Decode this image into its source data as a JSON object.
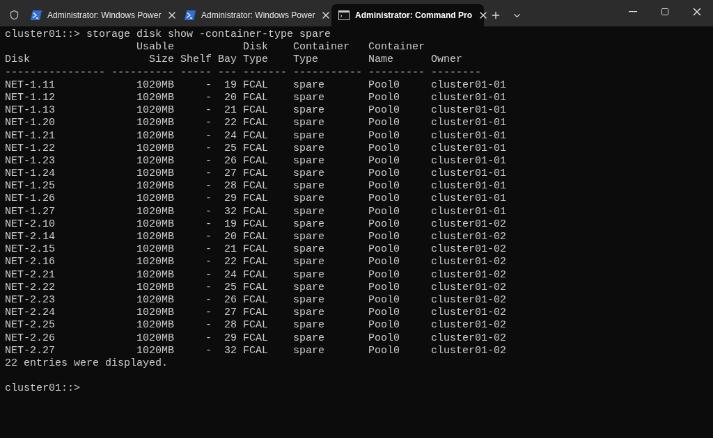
{
  "tabs": [
    {
      "kind": "powershell",
      "title": "Administrator: Windows Power",
      "selected": false
    },
    {
      "kind": "powershell",
      "title": "Administrator: Windows Power",
      "selected": false
    },
    {
      "kind": "cmd",
      "title": "Administrator: Command Pro",
      "selected": true
    }
  ],
  "terminal": {
    "prompt": "cluster01::>",
    "command": "storage disk show -container-type spare",
    "columns": [
      {
        "label": "Disk",
        "rule": "----------------",
        "kind": "text"
      },
      {
        "top": "Usable",
        "label": "Size",
        "rule": "----------",
        "kind": "number"
      },
      {
        "label": "Shelf",
        "rule": "-----",
        "kind": "number"
      },
      {
        "label": "Bay",
        "rule": "---",
        "kind": "number"
      },
      {
        "top": "Disk",
        "label": "Type",
        "rule": "-------",
        "kind": "text"
      },
      {
        "top": "Container",
        "label": "Type",
        "rule": "-----------",
        "kind": "text"
      },
      {
        "top": "Container",
        "label": "Name",
        "rule": "---------",
        "kind": "text"
      },
      {
        "label": "Owner",
        "rule": "--------",
        "kind": "text"
      }
    ],
    "rows": [
      [
        "NET-1.11",
        "1020MB",
        "-",
        "19",
        "FCAL",
        "spare",
        "Pool0",
        "cluster01-01"
      ],
      [
        "NET-1.12",
        "1020MB",
        "-",
        "20",
        "FCAL",
        "spare",
        "Pool0",
        "cluster01-01"
      ],
      [
        "NET-1.13",
        "1020MB",
        "-",
        "21",
        "FCAL",
        "spare",
        "Pool0",
        "cluster01-01"
      ],
      [
        "NET-1.20",
        "1020MB",
        "-",
        "22",
        "FCAL",
        "spare",
        "Pool0",
        "cluster01-01"
      ],
      [
        "NET-1.21",
        "1020MB",
        "-",
        "24",
        "FCAL",
        "spare",
        "Pool0",
        "cluster01-01"
      ],
      [
        "NET-1.22",
        "1020MB",
        "-",
        "25",
        "FCAL",
        "spare",
        "Pool0",
        "cluster01-01"
      ],
      [
        "NET-1.23",
        "1020MB",
        "-",
        "26",
        "FCAL",
        "spare",
        "Pool0",
        "cluster01-01"
      ],
      [
        "NET-1.24",
        "1020MB",
        "-",
        "27",
        "FCAL",
        "spare",
        "Pool0",
        "cluster01-01"
      ],
      [
        "NET-1.25",
        "1020MB",
        "-",
        "28",
        "FCAL",
        "spare",
        "Pool0",
        "cluster01-01"
      ],
      [
        "NET-1.26",
        "1020MB",
        "-",
        "29",
        "FCAL",
        "spare",
        "Pool0",
        "cluster01-01"
      ],
      [
        "NET-1.27",
        "1020MB",
        "-",
        "32",
        "FCAL",
        "spare",
        "Pool0",
        "cluster01-01"
      ],
      [
        "NET-2.10",
        "1020MB",
        "-",
        "19",
        "FCAL",
        "spare",
        "Pool0",
        "cluster01-02"
      ],
      [
        "NET-2.14",
        "1020MB",
        "-",
        "20",
        "FCAL",
        "spare",
        "Pool0",
        "cluster01-02"
      ],
      [
        "NET-2.15",
        "1020MB",
        "-",
        "21",
        "FCAL",
        "spare",
        "Pool0",
        "cluster01-02"
      ],
      [
        "NET-2.16",
        "1020MB",
        "-",
        "22",
        "FCAL",
        "spare",
        "Pool0",
        "cluster01-02"
      ],
      [
        "NET-2.21",
        "1020MB",
        "-",
        "24",
        "FCAL",
        "spare",
        "Pool0",
        "cluster01-02"
      ],
      [
        "NET-2.22",
        "1020MB",
        "-",
        "25",
        "FCAL",
        "spare",
        "Pool0",
        "cluster01-02"
      ],
      [
        "NET-2.23",
        "1020MB",
        "-",
        "26",
        "FCAL",
        "spare",
        "Pool0",
        "cluster01-02"
      ],
      [
        "NET-2.24",
        "1020MB",
        "-",
        "27",
        "FCAL",
        "spare",
        "Pool0",
        "cluster01-02"
      ],
      [
        "NET-2.25",
        "1020MB",
        "-",
        "28",
        "FCAL",
        "spare",
        "Pool0",
        "cluster01-02"
      ],
      [
        "NET-2.26",
        "1020MB",
        "-",
        "29",
        "FCAL",
        "spare",
        "Pool0",
        "cluster01-02"
      ],
      [
        "NET-2.27",
        "1020MB",
        "-",
        "32",
        "FCAL",
        "spare",
        "Pool0",
        "cluster01-02"
      ]
    ],
    "footer": "22 entries were displayed.",
    "final_prompt": "cluster01::>"
  }
}
